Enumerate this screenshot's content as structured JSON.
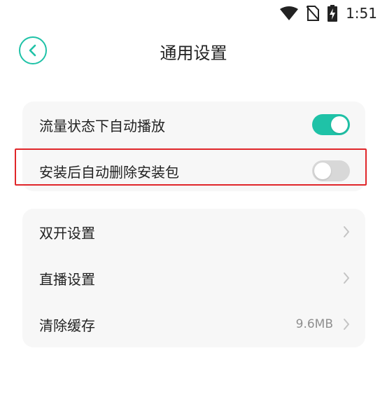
{
  "status": {
    "time": "1:51",
    "icons": [
      "wifi-icon",
      "no-sim-icon",
      "battery-charging-icon"
    ]
  },
  "header": {
    "title": "通用设置",
    "back_icon": "chevron-left-icon"
  },
  "colors": {
    "accent": "#1fc2a7",
    "highlight": "#e0262a",
    "card_bg": "#f7f7f7",
    "toggle_off": "#d8d8d8"
  },
  "group1": {
    "items": [
      {
        "label": "流量状态下自动播放",
        "toggle": true
      },
      {
        "label": "安装后自动删除安装包",
        "toggle": false
      }
    ]
  },
  "group2": {
    "items": [
      {
        "label": "双开设置",
        "value": "",
        "icon": "chevron-right-icon"
      },
      {
        "label": "直播设置",
        "value": "",
        "icon": "chevron-right-icon"
      },
      {
        "label": "清除缓存",
        "value": "9.6MB",
        "icon": "chevron-right-icon"
      }
    ]
  }
}
